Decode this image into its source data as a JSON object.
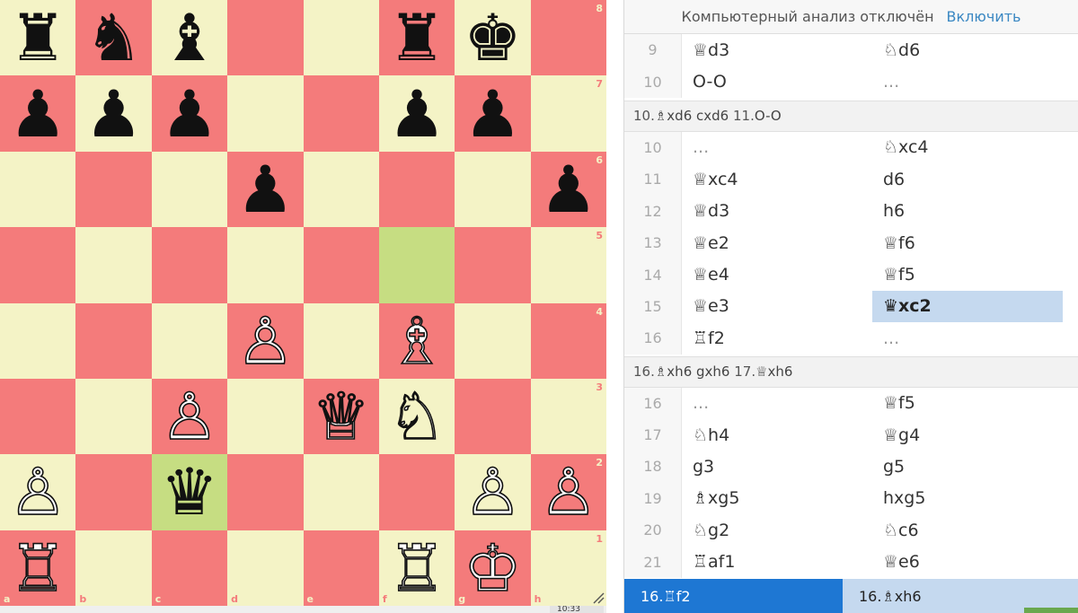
{
  "board": {
    "squares": [
      [
        "♜",
        "♞",
        "♝",
        "",
        "",
        "♜",
        "♚",
        ""
      ],
      [
        "♟",
        "♟",
        "♟",
        "",
        "",
        "♟",
        "♟",
        ""
      ],
      [
        "",
        "",
        "",
        "♟",
        "",
        "",
        "",
        "♟"
      ],
      [
        "",
        "",
        "",
        "",
        "",
        "",
        "",
        ""
      ],
      [
        "",
        "",
        "",
        "♙",
        "",
        "♗",
        "",
        ""
      ],
      [
        "",
        "",
        "♙",
        "",
        "♕",
        "♘",
        "",
        ""
      ],
      [
        "♙",
        "",
        "♛",
        "",
        "",
        "",
        "♙",
        "♙"
      ],
      [
        "♖",
        "",
        "",
        "",
        "",
        "♖",
        "♔",
        ""
      ]
    ],
    "colors": [
      [
        "b",
        "b",
        "b",
        "",
        "",
        "b",
        "b",
        ""
      ],
      [
        "b",
        "b",
        "b",
        "",
        "",
        "b",
        "b",
        ""
      ],
      [
        "",
        "",
        "",
        "b",
        "",
        "",
        "",
        "b"
      ],
      [
        "",
        "",
        "",
        "",
        "",
        "",
        "",
        ""
      ],
      [
        "",
        "",
        "",
        "w",
        "",
        "w",
        "",
        ""
      ],
      [
        "",
        "",
        "w",
        "",
        "w",
        "w",
        "",
        ""
      ],
      [
        "w",
        "",
        "b",
        "",
        "",
        "",
        "w",
        "w"
      ],
      [
        "w",
        "",
        "",
        "",
        "",
        "w",
        "w",
        ""
      ]
    ],
    "highlighted": [
      "f5",
      "c2"
    ],
    "ranks": [
      "8",
      "7",
      "6",
      "5",
      "4",
      "3",
      "2",
      "1"
    ],
    "files": [
      "a",
      "b",
      "c",
      "d",
      "e",
      "f",
      "g",
      "h"
    ],
    "light_color": "#f4f3c6",
    "dark_color": "#f47b7b",
    "highlight_color": "#c6dd82"
  },
  "clock_peek": "10:33",
  "analysis": {
    "text": "Компьютерный анализ отключён",
    "enable_label": "Включить"
  },
  "moves_top": [
    {
      "num": "9",
      "white": "♕d3",
      "black": "♘d6"
    },
    {
      "num": "10",
      "white": "O-O",
      "black": "..."
    }
  ],
  "variation1": {
    "num1": "10.",
    "text1": "♗xd6 cxd6",
    "num2": "11.",
    "text2": "O-O"
  },
  "moves_mid": [
    {
      "num": "10",
      "white": "...",
      "black": "♘xc4"
    },
    {
      "num": "11",
      "white": "♕xc4",
      "black": "d6"
    },
    {
      "num": "12",
      "white": "♕d3",
      "black": "h6"
    },
    {
      "num": "13",
      "white": "♕e2",
      "black": "♕f6"
    },
    {
      "num": "14",
      "white": "♕e4",
      "black": "♕f5"
    },
    {
      "num": "15",
      "white": "♕e3",
      "black": "♛xc2"
    },
    {
      "num": "16",
      "white": "♖f2",
      "black": "..."
    }
  ],
  "variation2": {
    "num1": "16.",
    "text1": "♗xh6 gxh6",
    "num2": "17.",
    "text2": "♕xh6"
  },
  "moves_bottom": [
    {
      "num": "16",
      "white": "...",
      "black": "♕f5"
    },
    {
      "num": "17",
      "white": "♘h4",
      "black": "♕g4"
    },
    {
      "num": "18",
      "white": "g3",
      "black": "g5"
    },
    {
      "num": "19",
      "white": "♗xg5",
      "black": "hxg5"
    },
    {
      "num": "20",
      "white": "♘g2",
      "black": "♘c6"
    },
    {
      "num": "21",
      "white": "♖af1",
      "black": "♕e6"
    }
  ],
  "footer": {
    "left": "16.♖f2",
    "right": "16.♗xh6"
  },
  "active_move": "15-black",
  "accent_blue": "#1e77d3",
  "selection_blue": "#c5d9ef"
}
